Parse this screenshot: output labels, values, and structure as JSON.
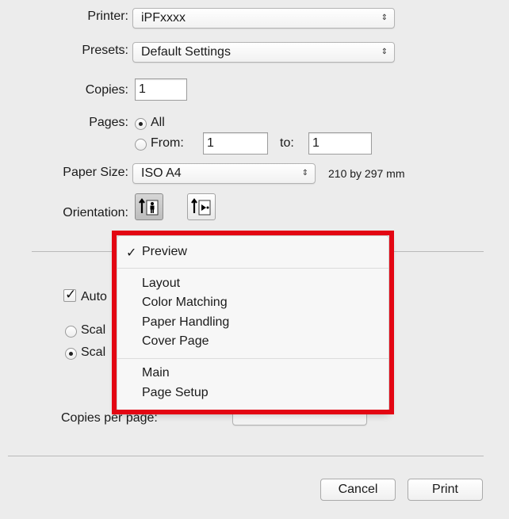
{
  "printer": {
    "label": "Printer:",
    "value": "iPFxxxx"
  },
  "presets": {
    "label": "Presets:",
    "value": "Default Settings"
  },
  "copies": {
    "label": "Copies:",
    "value": "1"
  },
  "pages": {
    "label": "Pages:",
    "all_label": "All",
    "from_label": "From:",
    "from_value": "1",
    "to_label": "to:",
    "to_value": "1",
    "selected": "All"
  },
  "paper_size": {
    "label": "Paper Size:",
    "value": "ISO A4",
    "dimensions": "210 by 297 mm"
  },
  "orientation": {
    "label": "Orientation:",
    "selected": "portrait"
  },
  "popup_arrows": "⇕",
  "hidden_controls": {
    "auto_label": "Auto",
    "scale1_label": "Scal",
    "scale2_label": "Scal",
    "copies_per_page_label": "Copies per page:",
    "auto_checked": true
  },
  "menu": {
    "items": [
      {
        "label": "Preview",
        "checked": true
      },
      {
        "label": "Layout"
      },
      {
        "label": "Color Matching"
      },
      {
        "label": "Paper Handling"
      },
      {
        "label": "Cover Page"
      },
      {
        "label": "Main"
      },
      {
        "label": "Page Setup"
      }
    ],
    "check_mark": "✓"
  },
  "buttons": {
    "cancel": "Cancel",
    "print": "Print"
  },
  "colors": {
    "highlight": "#e30613",
    "background": "#ececec"
  }
}
